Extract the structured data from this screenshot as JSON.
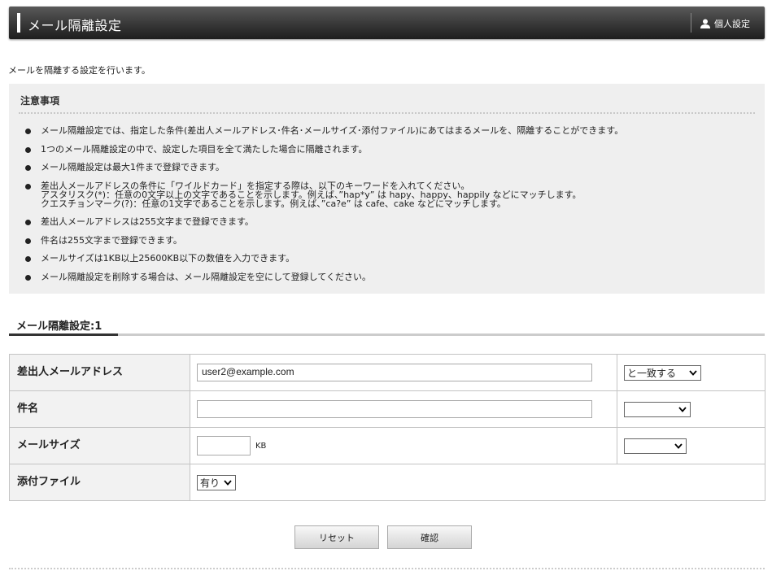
{
  "header": {
    "title": "メール隔離設定",
    "user_label": "個人設定"
  },
  "intro": "メールを隔離する設定を行います。",
  "notes": {
    "title": "注意事項",
    "items": [
      [
        "メール隔離設定では、指定した条件(差出人メールアドレス･件名･メールサイズ･添付ファイル)にあてはまるメールを、隔離することができます。"
      ],
      [
        "1つのメール隔離設定の中で、設定した項目を全て満たした場合に隔離されます。"
      ],
      [
        "メール隔離設定は最大1件まで登録できます。"
      ],
      [
        "差出人メールアドレスの条件に「ワイルドカード」を指定する際は、以下のキーワードを入れてください。",
        "アスタリスク(*)：任意の0文字以上の文字であることを示します。例えば、”hap*y” は hapy、happy、happily などにマッチします。",
        "クエスチョンマーク(?)：任意の1文字であることを示します。例えば、”ca?e” は cafe、cake などにマッチします。"
      ],
      [
        "差出人メールアドレスは255文字まで登録できます。"
      ],
      [
        "件名は255文字まで登録できます。"
      ],
      [
        "メールサイズは1KB以上25600KB以下の数値を入力できます。"
      ],
      [
        "メール隔離設定を削除する場合は、メール隔離設定を空にして登録してください。"
      ]
    ]
  },
  "section": {
    "title": "メール隔離設定:1"
  },
  "form": {
    "sender": {
      "label": "差出人メールアドレス",
      "value": "user2@example.com",
      "match": "と一致する"
    },
    "subject": {
      "label": "件名",
      "value": "",
      "match": ""
    },
    "size": {
      "label": "メールサイズ",
      "value": "",
      "unit": "KB",
      "match": ""
    },
    "attachment": {
      "label": "添付ファイル",
      "value": "有り"
    }
  },
  "buttons": {
    "reset": "リセット",
    "confirm": "確認"
  }
}
